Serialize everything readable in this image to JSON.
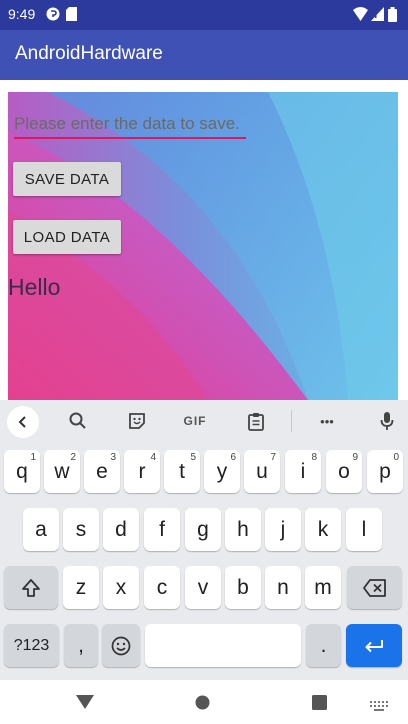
{
  "status_bar": {
    "time": "9:49"
  },
  "app": {
    "title": "AndroidHardware"
  },
  "form": {
    "input_placeholder": "Please enter the data to save.",
    "save_label": "SAVE DATA",
    "load_label": "LOAD DATA",
    "output_text": "Hello"
  },
  "keyboard": {
    "toolbar": {
      "gif_label": "GIF",
      "more_label": "•••"
    },
    "row1": [
      {
        "k": "q",
        "h": "1"
      },
      {
        "k": "w",
        "h": "2"
      },
      {
        "k": "e",
        "h": "3"
      },
      {
        "k": "r",
        "h": "4"
      },
      {
        "k": "t",
        "h": "5"
      },
      {
        "k": "y",
        "h": "6"
      },
      {
        "k": "u",
        "h": "7"
      },
      {
        "k": "i",
        "h": "8"
      },
      {
        "k": "o",
        "h": "9"
      },
      {
        "k": "p",
        "h": "0"
      }
    ],
    "row2": [
      "a",
      "s",
      "d",
      "f",
      "g",
      "h",
      "j",
      "k",
      "l"
    ],
    "row3": [
      "z",
      "x",
      "c",
      "v",
      "b",
      "n",
      "m"
    ],
    "symbols_label": "?123",
    "comma_label": ",",
    "period_label": "."
  },
  "colors": {
    "status_bar": "#2b3a9c",
    "app_bar": "#3f51b5",
    "accent": "#d81b60",
    "enter_key": "#1a73e8"
  }
}
